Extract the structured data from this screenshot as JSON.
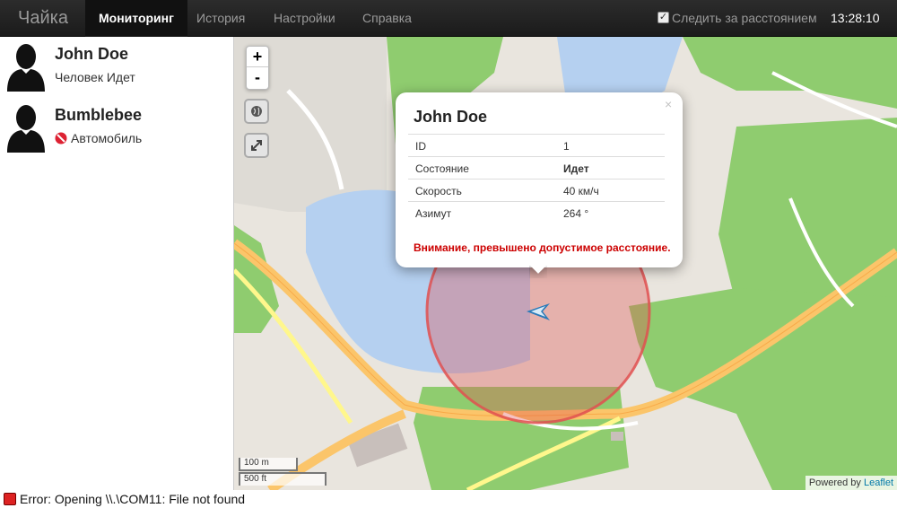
{
  "app": {
    "brand": "Чайка"
  },
  "nav": {
    "items": [
      {
        "label": "Мониторинг",
        "active": true
      },
      {
        "label": "История",
        "active": false
      },
      {
        "label": "Настройки",
        "active": false
      },
      {
        "label": "Справка",
        "active": false
      }
    ],
    "track_distance": {
      "label": "Следить за расстоянием",
      "checked": true
    },
    "time": "13:28:10"
  },
  "sidebar": {
    "devices": [
      {
        "name": "John Doe",
        "status": "Человек Идет",
        "icon": "person-silhouette-icon"
      },
      {
        "name": "Bumblebee",
        "status": "Автомобиль",
        "status_icon": "no-entry-icon",
        "icon": "person-silhouette-icon"
      }
    ]
  },
  "map": {
    "zoom_in": "+",
    "zoom_out": "-",
    "scale_metric": "100 m",
    "scale_imperial": "500 ft",
    "attribution_prefix": "Powered by",
    "attribution_link": "Leaflet",
    "geofence_color": "#e05050",
    "marker_color": "#2a7ab8"
  },
  "popup": {
    "title": "John Doe",
    "close": "×",
    "rows": [
      {
        "key": "ID",
        "value": "1"
      },
      {
        "key": "Состояние",
        "value": "Идет"
      },
      {
        "key": "Скорость",
        "value": "40 км/ч"
      },
      {
        "key": "Азимут",
        "value": "264 °"
      }
    ],
    "warning": "Внимание, превышено допустимое расстояние."
  },
  "statusbar": {
    "error": "Error: Opening \\\\.\\COM11: File not found"
  }
}
